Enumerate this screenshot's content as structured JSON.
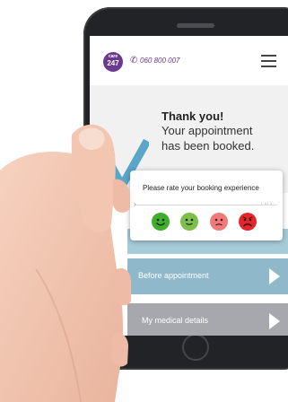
{
  "header": {
    "logo_top": "care",
    "logo_bottom": "247",
    "phone_number": "060 800 007"
  },
  "confirmation": {
    "title": "Thank you!",
    "line1": "Your appointment",
    "line2": "has been booked."
  },
  "rating": {
    "prompt": "Please rate your booking experience",
    "pager_text": "· 1 of 1 ·",
    "faces": [
      {
        "name": "very-happy-face-icon",
        "color": "#3fae2a"
      },
      {
        "name": "happy-face-icon",
        "color": "#7cc04a"
      },
      {
        "name": "sad-face-icon",
        "color": "#f07a7a"
      },
      {
        "name": "very-sad-face-icon",
        "color": "#e2262a"
      }
    ]
  },
  "menu": {
    "items": [
      {
        "label": ""
      },
      {
        "label": "Before appointment"
      },
      {
        "label": "My medical details"
      }
    ]
  },
  "colors": {
    "brand": "#6b3a8e",
    "row_blue": "#8fb9cb",
    "row_grey": "#a7a8ad",
    "check_blue": "#5aa6c9"
  }
}
